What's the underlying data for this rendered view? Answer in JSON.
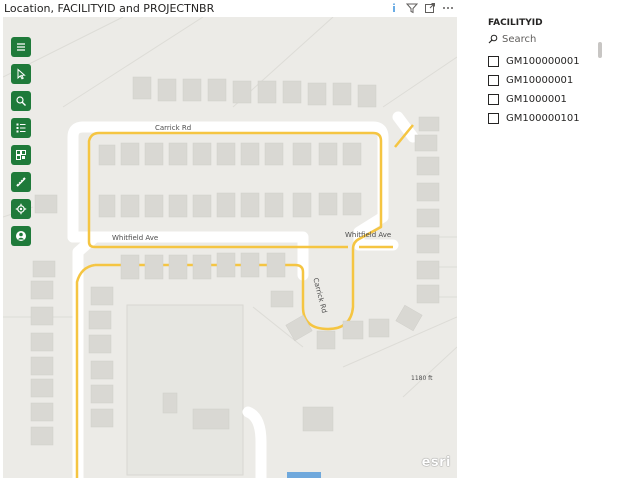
{
  "visual": {
    "title": "Location, FACILITYID and PROJECTNBR",
    "header_icons": [
      "info-icon",
      "filter-icon",
      "focus-mode-icon",
      "more-options-icon"
    ],
    "more_options_label": "···"
  },
  "map": {
    "toolbar": [
      "menu-icon",
      "select-icon",
      "search-icon",
      "layers-icon",
      "qr-icon",
      "measure-icon",
      "settings-icon",
      "account-icon"
    ],
    "toolbar_color": "#1f7a3a",
    "street_labels": {
      "carrick_rd_top": "Carrick Rd",
      "whitfield_ave_left": "Whitfield Ave",
      "whitfield_ave_right": "Whitfield Ave",
      "carrick_rd_cul": "Carrick Rd",
      "elevation": "1180 ft"
    },
    "attribution": "esri",
    "road_color": "#f5c542"
  },
  "slicer": {
    "header": "FACILITYID",
    "search_placeholder": "Search",
    "items": [
      "GM100000001",
      "GM10000001",
      "GM1000001",
      "GM100000101"
    ]
  }
}
